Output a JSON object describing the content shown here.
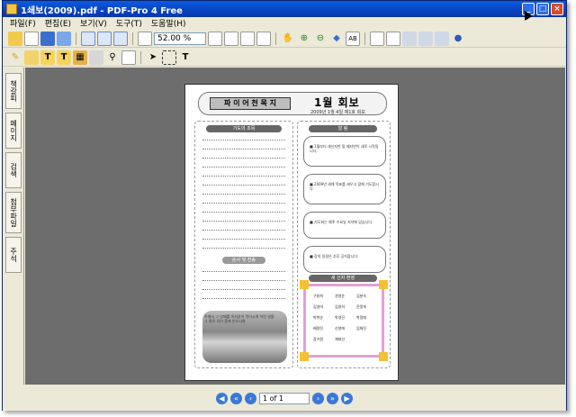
{
  "window": {
    "title": "1쇄보(2009).pdf - PDF-Pro 4 Free",
    "buttons": [
      "_",
      "□",
      "×"
    ]
  },
  "menu": [
    "파일(F)",
    "편집(E)",
    "보기(V)",
    "도구(T)",
    "도움말(H)"
  ],
  "toolbar1": {
    "zoom_value": "52.00 %",
    "icons": [
      "open-folder",
      "new",
      "save",
      "email",
      "pdf1",
      "pdf2",
      "pdf3",
      "page",
      "fit-page",
      "fit-width",
      "fit-height",
      "actual",
      "hand",
      "zoom-in",
      "zoom-out",
      "eraser",
      "ab",
      "doc1",
      "doc2",
      "doc3",
      "doc4",
      "doc5",
      "doc6"
    ]
  },
  "toolbar2": {
    "icons": [
      "brush",
      "text-t",
      "text-t2",
      "grid",
      "text-box",
      "link",
      "note",
      "arrow",
      "select",
      "text-edit"
    ]
  },
  "sidebar": {
    "tabs": [
      "책갈피",
      "페이지",
      "검색",
      "첨부파일",
      "주석"
    ]
  },
  "document": {
    "logo_text": "파 이 어 천 목 지",
    "month_title": "1월 회보",
    "date_text": "2009년 1월 4일   제1호 회보",
    "left_bar1": "기도의 조목",
    "left_bar2": "순서 및 찬송",
    "right_bar1": "알 림",
    "right_bar2": "새 신자 환영",
    "notices": [
      "■ 1월부터 새신자반 및 제자반이 새로 시작됩니다.",
      "■ 2009년 새해 목표를 세우고 함께 기도합시다.",
      "■ 기도회는 매주 수요일 저녁에 있습니다.",
      "■ 강의 일정은 추후 공지합니다."
    ],
    "names": [
      [
        "구창희",
        "권영순",
        "김분숙"
      ],
      [
        "김영미",
        "김영석",
        "문정희"
      ],
      [
        "박복순",
        "박영진",
        "박정애"
      ],
      [
        "배명진",
        "신영애",
        "임채진"
      ],
      [
        "장기원",
        "채태선",
        ""
      ]
    ],
    "photo_caption": "주께서 그 양떼를 목자같이 먹이시며 어린 양을 그 팔로 모아 품에 안으시며"
  },
  "statusbar": {
    "page_input": "1 of 1"
  }
}
